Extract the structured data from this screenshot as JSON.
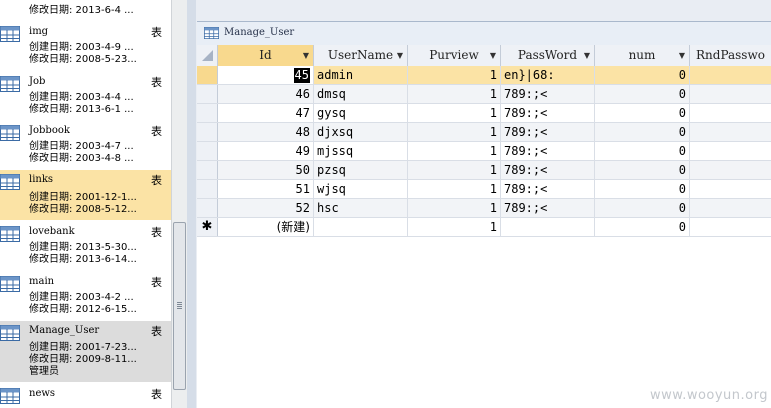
{
  "nav": {
    "top_partial": "修改日期: 2013-6-4 ...",
    "items": [
      {
        "name": "img",
        "type": "表",
        "created": "创建日期: 2003-4-9 ...",
        "modified": "修改日期: 2008-5-23..."
      },
      {
        "name": "Job",
        "type": "表",
        "created": "创建日期: 2003-4-4 ...",
        "modified": "修改日期: 2013-6-1 ..."
      },
      {
        "name": "Jobbook",
        "type": "表",
        "created": "创建日期: 2003-4-7 ...",
        "modified": "修改日期: 2003-4-8 ..."
      },
      {
        "name": "links",
        "type": "表",
        "created": "创建日期: 2001-12-1...",
        "modified": "修改日期: 2008-5-12..."
      },
      {
        "name": "lovebank",
        "type": "表",
        "created": "创建日期: 2013-5-30...",
        "modified": "修改日期: 2013-6-14..."
      },
      {
        "name": "main",
        "type": "表",
        "created": "创建日期: 2003-4-2 ...",
        "modified": "修改日期: 2012-6-15..."
      },
      {
        "name": "Manage_User",
        "type": "表",
        "created": "创建日期: 2001-7-23...",
        "modified": "修改日期: 2009-8-11...",
        "owner": "管理员"
      },
      {
        "name": "news",
        "type": "表",
        "created": "",
        "modified": ""
      }
    ]
  },
  "tab": {
    "title": "Manage_User"
  },
  "grid": {
    "columns": [
      "Id",
      "UserName",
      "Purview",
      "PassWord",
      "num",
      "RndPasswo"
    ],
    "rows": [
      {
        "id": "45",
        "username": "admin",
        "purview": "1",
        "password": "en}|68:",
        "num": "0"
      },
      {
        "id": "46",
        "username": "dmsq",
        "purview": "1",
        "password": "789:;<",
        "num": "0"
      },
      {
        "id": "47",
        "username": "gysq",
        "purview": "1",
        "password": "789:;<",
        "num": "0"
      },
      {
        "id": "48",
        "username": "djxsq",
        "purview": "1",
        "password": "789:;<",
        "num": "0"
      },
      {
        "id": "49",
        "username": "mjssq",
        "purview": "1",
        "password": "789:;<",
        "num": "0"
      },
      {
        "id": "50",
        "username": "pzsq",
        "purview": "1",
        "password": "789:;<",
        "num": "0"
      },
      {
        "id": "51",
        "username": "wjsq",
        "purview": "1",
        "password": "789:;<",
        "num": "0"
      },
      {
        "id": "52",
        "username": "hsc",
        "purview": "1",
        "password": "789:;<",
        "num": "0"
      }
    ],
    "new_row": {
      "marker": "✱",
      "id": "(新建)",
      "purview": "1",
      "num": "0"
    }
  },
  "watermark": "www.wooyun.org",
  "colors": {
    "highlight": "#fbe3a5",
    "header_active": "#f8d98e",
    "selected_nav": "#dcdcdc"
  }
}
